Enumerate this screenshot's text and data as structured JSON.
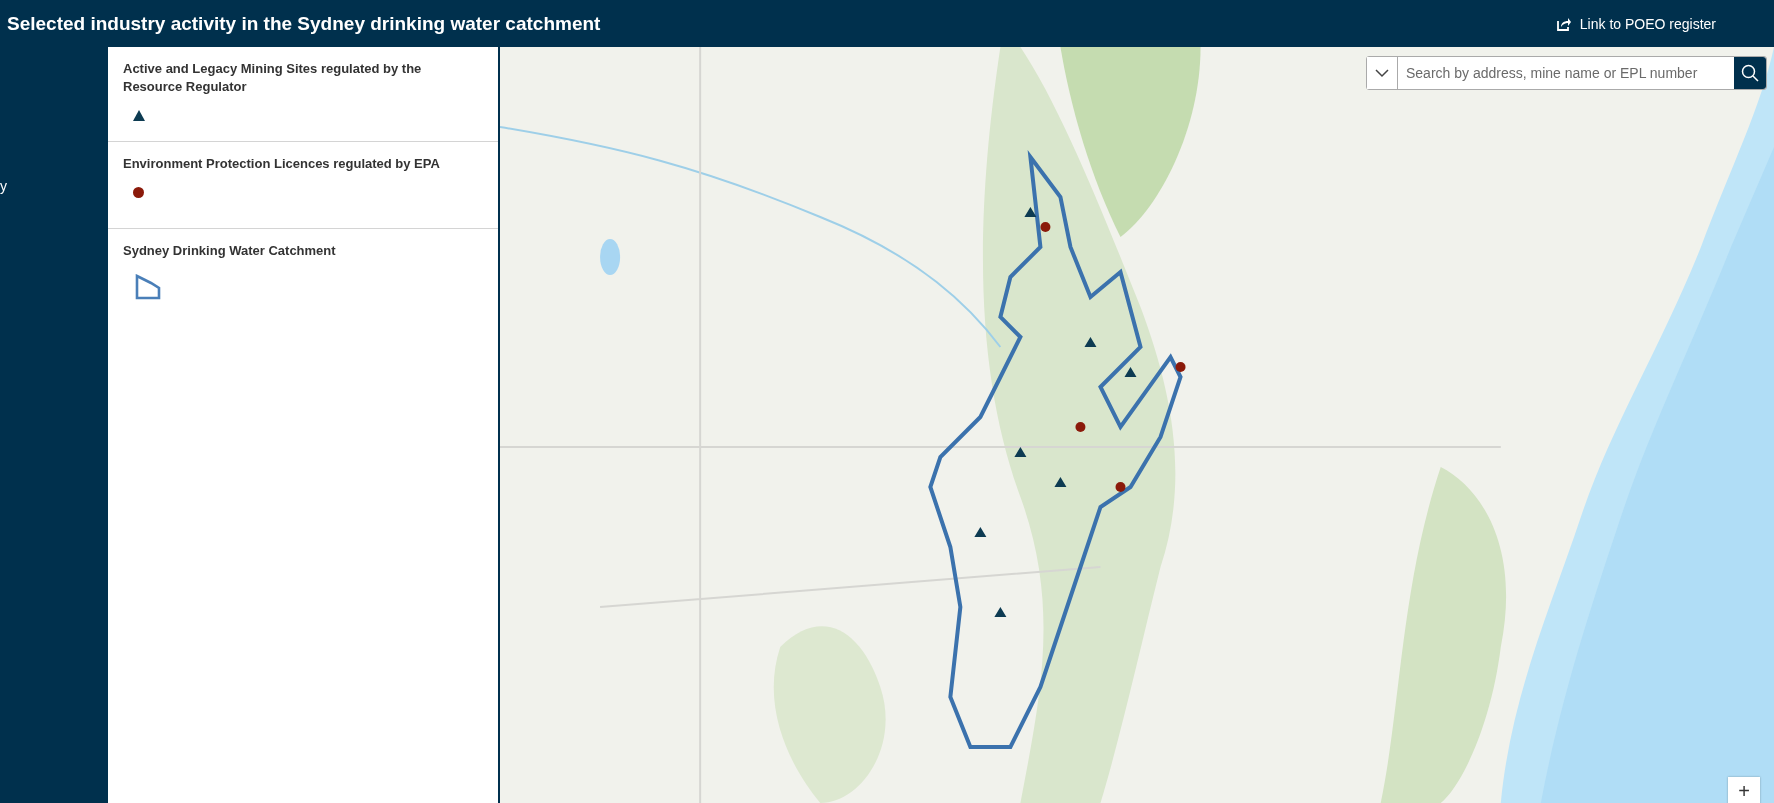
{
  "header": {
    "title": "Selected industry activity in the Sydney drinking water catchment",
    "link": "Link to POEO register"
  },
  "side_strip": {
    "text": "y"
  },
  "legend": [
    {
      "kind": "triangle",
      "label": "Active and Legacy Mining Sites regulated by the Resource Regulator",
      "color": "#0d3b52"
    },
    {
      "kind": "dot",
      "label": "Environment Protection Licences regulated by EPA",
      "color": "#8b1a0a"
    },
    {
      "kind": "polygon",
      "label": "Sydney Drinking Water Catchment",
      "color": "#4a7fb8"
    }
  ],
  "map": {
    "kind": "picture",
    "search": {
      "placeholder": "Search by address, mine name or EPL number"
    },
    "zoom_in": "+"
  }
}
